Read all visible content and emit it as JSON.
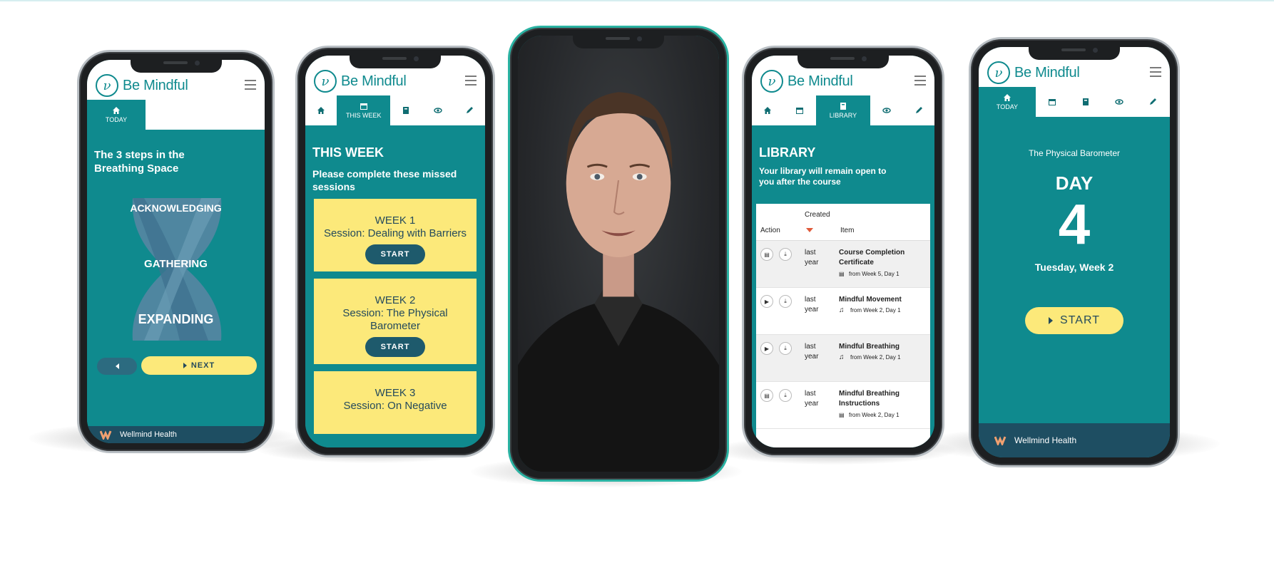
{
  "brand": {
    "name": "Be Mindful",
    "footer_name": "Wellmind Health",
    "accent": "#0f8a8e",
    "yellow": "#fce97a",
    "navy": "#1e4e62"
  },
  "phone1": {
    "tab_label": "TODAY",
    "title": "The 3 steps in the Breathing Space",
    "steps": [
      "ACKNOWLEDGING",
      "GATHERING",
      "EXPANDING"
    ],
    "next_label": "NEXT",
    "footer_partial": "Wellmind Health"
  },
  "phone2": {
    "tab_label": "THIS WEEK",
    "title": "THIS WEEK",
    "subtitle": "Please complete these missed sessions",
    "cards": [
      {
        "week": "WEEK 1",
        "session": "Session: Dealing with Barriers",
        "button": "START"
      },
      {
        "week": "WEEK 2",
        "session": "Session: The Physical Barometer",
        "button": "START"
      },
      {
        "week": "WEEK 3",
        "session": "Session: On Negative",
        "button": ""
      }
    ]
  },
  "phone4": {
    "tab_label": "LIBRARY",
    "title": "LIBRARY",
    "subtitle": "Your library will remain open to you after the course",
    "headers": {
      "action": "Action",
      "created": "Created",
      "item": "Item"
    },
    "rows": [
      {
        "created": "last year",
        "title": "Course Completion Certificate",
        "from": "from Week 5, Day 1",
        "kind": "document"
      },
      {
        "created": "last year",
        "title": "Mindful Movement",
        "from": "from Week 2, Day 1",
        "kind": "audio"
      },
      {
        "created": "last year",
        "title": "Mindful Breathing",
        "from": "from Week 2, Day 1",
        "kind": "audio"
      },
      {
        "created": "last year",
        "title": "Mindful Breathing Instructions",
        "from": "from Week 2, Day 1",
        "kind": "document"
      }
    ]
  },
  "phone5": {
    "tab_label": "TODAY",
    "session_title": "The Physical Barometer",
    "day_label": "DAY",
    "day_number": "4",
    "date_label": "Tuesday, Week 2",
    "start_label": "START"
  }
}
